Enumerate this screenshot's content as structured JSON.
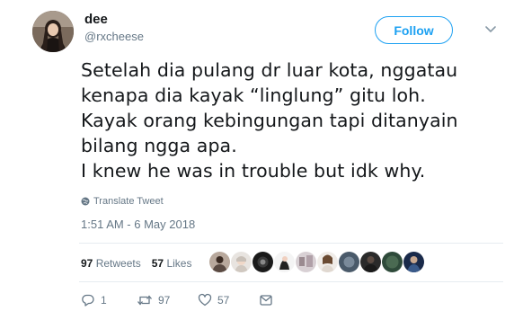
{
  "user": {
    "name": "dee",
    "handle": "@rxcheese"
  },
  "follow_label": "Follow",
  "tweet": {
    "lines": [
      "Setelah dia pulang dr luar kota, nggatau",
      "kenapa dia kayak “linglung” gitu loh.",
      "Kayak orang kebingungan tapi ditanyain",
      "bilang ngga apa.",
      "I knew he was in trouble but idk why."
    ]
  },
  "translate_label": "Translate Tweet",
  "timestamp": "1:51 AM - 6 May 2018",
  "stats": {
    "retweets_count": "97",
    "retweets_label": "Retweets",
    "likes_count": "57",
    "likes_label": "Likes"
  },
  "actions": {
    "reply_count": "1",
    "retweet_count": "97",
    "like_count": "57"
  },
  "colors": {
    "accent": "#1da1f2",
    "text": "#14171a",
    "muted": "#657786",
    "divider": "#e6ecf0"
  },
  "icons": [
    "caret-down-icon",
    "globe-icon",
    "reply-icon",
    "retweet-icon",
    "heart-icon",
    "message-icon"
  ]
}
